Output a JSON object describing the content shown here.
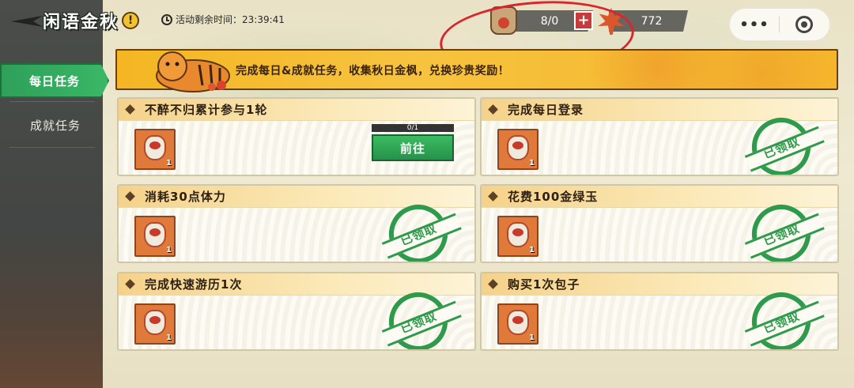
{
  "header": {
    "logo_title": "闲语金秋",
    "warning_glyph": "!",
    "timer_label": "活动剩余时间：23:39:41"
  },
  "currency": {
    "bag_count": "8/0",
    "plus_glyph": "+",
    "leaf_count": "772"
  },
  "mini_menu": {
    "dots": "•••"
  },
  "sidebar": {
    "items": [
      {
        "label": "每日任务",
        "active": true
      },
      {
        "label": "成就任务",
        "active": false
      }
    ]
  },
  "banner": {
    "text": "完成每日&成就任务，收集秋日金枫，兑换珍贵奖励！"
  },
  "tasks": [
    {
      "title": "不醉不归累计参与1轮",
      "reward_count": "1",
      "status": "go",
      "progress": "0/1",
      "button_label": "前往"
    },
    {
      "title": "完成每日登录",
      "reward_count": "1",
      "status": "claimed",
      "stamp_label": "已领取"
    },
    {
      "title": "消耗30点体力",
      "reward_count": "1",
      "status": "claimed",
      "stamp_label": "已领取"
    },
    {
      "title": "花费100金绿玉",
      "reward_count": "1",
      "status": "claimed",
      "stamp_label": "已领取"
    },
    {
      "title": "完成快速游历1次",
      "reward_count": "1",
      "status": "claimed",
      "stamp_label": "已领取"
    },
    {
      "title": "购买1次包子",
      "reward_count": "1",
      "status": "claimed",
      "stamp_label": "已领取"
    }
  ],
  "colors": {
    "accent_green": "#2e9a4b",
    "banner_yellow": "#f5b52b",
    "annotation_red": "#d8262d"
  }
}
